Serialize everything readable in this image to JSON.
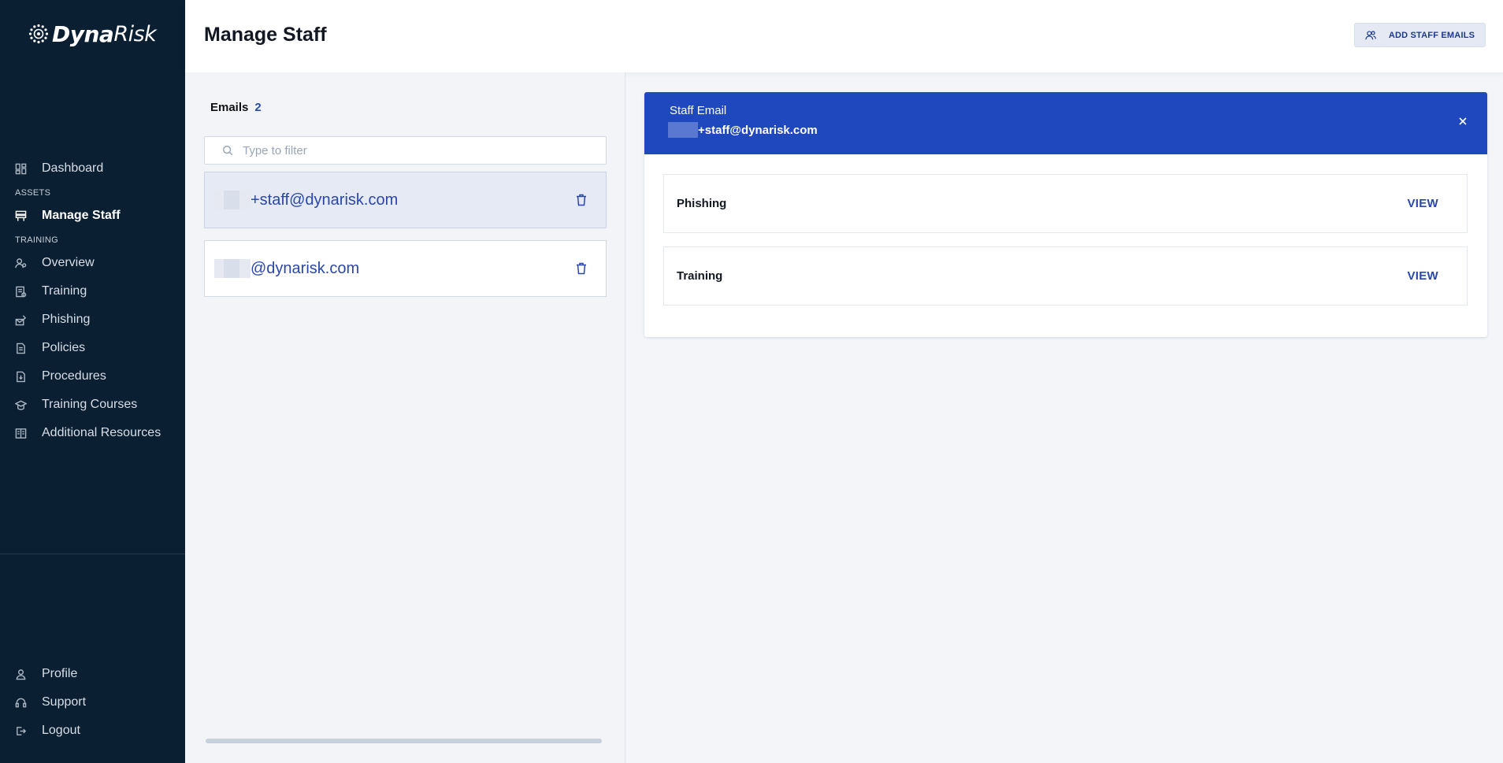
{
  "brand": {
    "part1": "Dyna",
    "part2": "Risk"
  },
  "sidebar": {
    "items": [
      {
        "label": "Dashboard",
        "icon": "dashboard-icon"
      },
      {
        "label": "Manage Staff",
        "icon": "staff-icon",
        "active": true
      },
      {
        "label": "Overview",
        "icon": "overview-icon"
      },
      {
        "label": "Training",
        "icon": "training-icon"
      },
      {
        "label": "Phishing",
        "icon": "phishing-icon"
      },
      {
        "label": "Policies",
        "icon": "policies-icon"
      },
      {
        "label": "Procedures",
        "icon": "procedures-icon"
      },
      {
        "label": "Training Courses",
        "icon": "courses-icon"
      },
      {
        "label": "Additional Resources",
        "icon": "resources-icon"
      }
    ],
    "sections": {
      "assets": "ASSETS",
      "training": "TRAINING"
    },
    "bottom": [
      {
        "label": "Profile",
        "icon": "profile-icon"
      },
      {
        "label": "Support",
        "icon": "support-icon"
      },
      {
        "label": "Logout",
        "icon": "logout-icon"
      }
    ]
  },
  "header": {
    "title": "Manage Staff",
    "add_button": "ADD STAFF EMAILS"
  },
  "emails": {
    "heading": "Emails",
    "count": "2",
    "filter_placeholder": "Type to filter",
    "list": [
      {
        "text": "+staff@dynarisk.com",
        "selected": true
      },
      {
        "text": "@dynarisk.com",
        "selected": false
      }
    ]
  },
  "detail": {
    "label": "Staff Email",
    "email": "+staff@dynarisk.com",
    "cards": [
      {
        "title": "Phishing",
        "action": "VIEW"
      },
      {
        "title": "Training",
        "action": "VIEW"
      }
    ]
  },
  "colors": {
    "sidebar": "#0b1f33",
    "accent": "#1f48be",
    "link": "#2a47ad"
  }
}
